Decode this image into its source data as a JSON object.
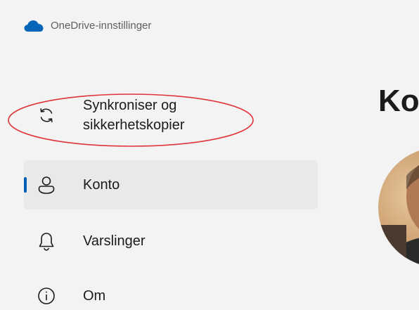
{
  "app": {
    "title": "OneDrive-innstillinger"
  },
  "sidebar": {
    "items": [
      {
        "label": "Synkroniser og sikkerhetskopier",
        "icon": "sync-icon",
        "selected": false
      },
      {
        "label": "Konto",
        "icon": "person-icon",
        "selected": true
      },
      {
        "label": "Varslinger",
        "icon": "bell-icon",
        "selected": false
      },
      {
        "label": "Om",
        "icon": "info-icon",
        "selected": false
      }
    ]
  },
  "main": {
    "heading": "Ko"
  },
  "colors": {
    "background": "#f3f3f3",
    "selected_background": "#e9e9e9",
    "accent": "#005fb8",
    "cloud": "#0364b8",
    "annotation": "#e0343a"
  }
}
